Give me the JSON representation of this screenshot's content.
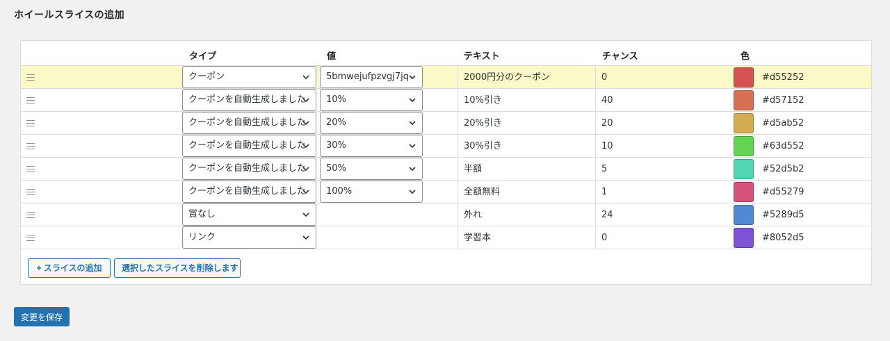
{
  "page": {
    "title": "ホイールスライスの追加",
    "save_label": "変更を保存"
  },
  "table": {
    "headers": {
      "type": "タイプ",
      "value": "値",
      "text": "テキスト",
      "chance": "チャンス",
      "color": "色"
    },
    "rows": [
      {
        "type": "クーポン",
        "value": "5bmwejufpzvgj7jq",
        "text": "2000円分のクーポン",
        "chance": "0",
        "color": "#d55252",
        "highlight": true
      },
      {
        "type": "クーポンを自動生成しました",
        "value": "10%",
        "text": "10%引き",
        "chance": "40",
        "color": "#d57152"
      },
      {
        "type": "クーポンを自動生成しました",
        "value": "20%",
        "text": "20%引き",
        "chance": "20",
        "color": "#d5ab52"
      },
      {
        "type": "クーポンを自動生成しました",
        "value": "30%",
        "text": "30%引き",
        "chance": "10",
        "color": "#63d552"
      },
      {
        "type": "クーポンを自動生成しました",
        "value": "50%",
        "text": "半額",
        "chance": "5",
        "color": "#52d5b2"
      },
      {
        "type": "クーポンを自動生成しました",
        "value": "100%",
        "text": "全額無料",
        "chance": "1",
        "color": "#d55279"
      },
      {
        "type": "賞なし",
        "value": null,
        "text": "外れ",
        "chance": "24",
        "color": "#5289d5"
      },
      {
        "type": "リンク",
        "value": null,
        "text": "学習本",
        "chance": "0",
        "color": "#8052d5"
      }
    ]
  },
  "actions": {
    "add_slice": "+ スライスの追加",
    "delete_selected": "選択したスライスを削除します"
  },
  "icons": {
    "drag": "drag-handle-icon",
    "dropdown": "chevron-down-icon"
  },
  "colors": {
    "primary": "#2271b1",
    "highlight_row": "#fcf9c9"
  }
}
